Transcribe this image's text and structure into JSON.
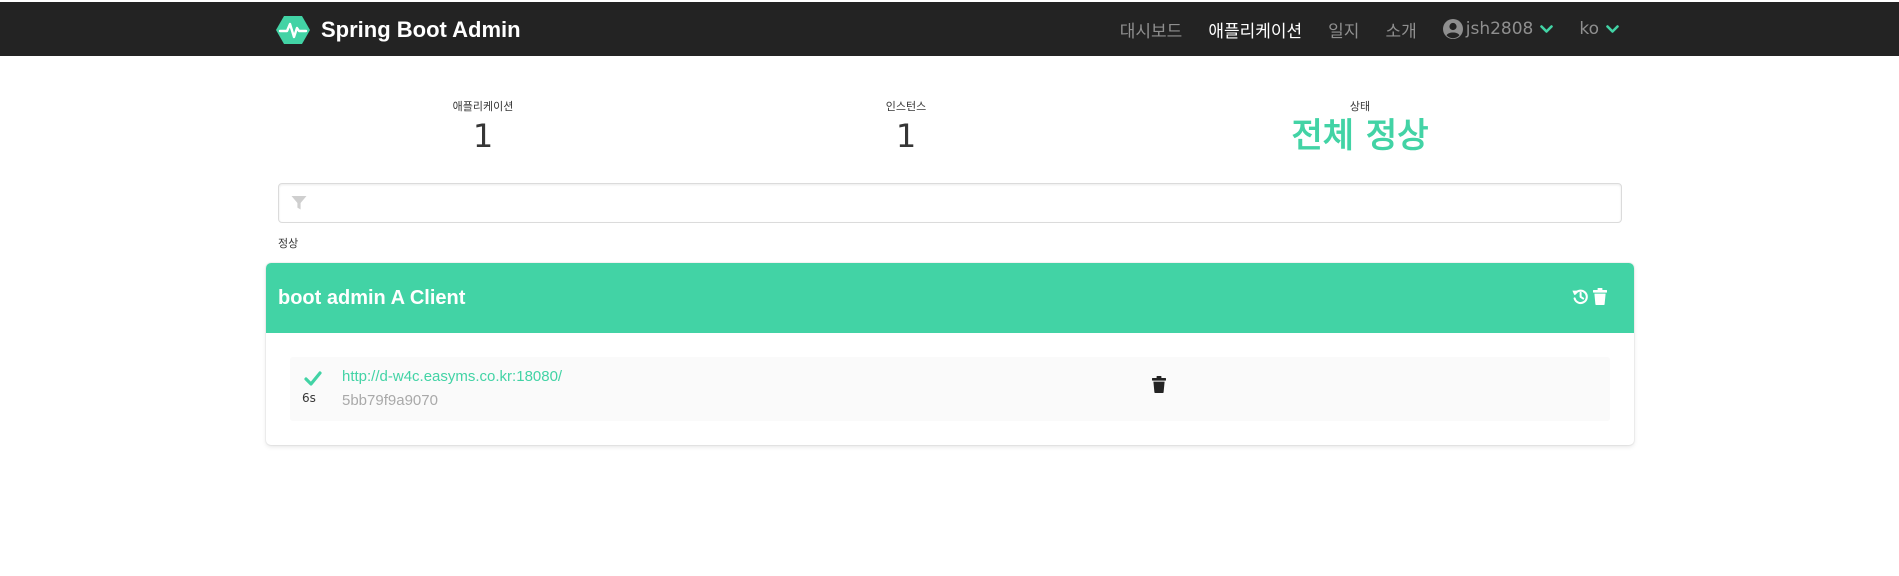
{
  "navbar": {
    "brand": {
      "logo_icon": "heartbeat-hexagon-icon",
      "title": "Spring Boot Admin"
    },
    "items": [
      {
        "label": "대시보드",
        "active": false
      },
      {
        "label": "애플리케이션",
        "active": true
      },
      {
        "label": "일지",
        "active": false
      },
      {
        "label": "소개",
        "active": false
      }
    ],
    "user": {
      "icon": "user-circle-icon",
      "name": "jsh2808",
      "dropdown_icon": "chevron-down-icon"
    },
    "language": {
      "value": "ko",
      "dropdown_icon": "chevron-down-icon"
    }
  },
  "summary": {
    "applications": {
      "label": "애플리케이션",
      "value": "1"
    },
    "instances": {
      "label": "인스턴스",
      "value": "1"
    },
    "status": {
      "label": "상태",
      "value": "전체 정상"
    }
  },
  "filter": {
    "icon": "filter-icon",
    "value": "",
    "placeholder": ""
  },
  "group": {
    "status_label": "정상",
    "application": {
      "name": "boot admin A Client",
      "actions": [
        {
          "icon": "history-icon"
        },
        {
          "icon": "trash-icon"
        }
      ],
      "instances": [
        {
          "status_icon": "check-icon",
          "age": "6s",
          "url": "http://d-w4c.easyms.co.kr:18080/",
          "id": "5bb79f9a9070",
          "delete_icon": "trash-icon"
        }
      ]
    }
  },
  "colors": {
    "navbar_bg": "#232323",
    "accent": "#42d3a5",
    "status_up": "#42d3a5",
    "text": "#363636",
    "muted": "#a9a9a9"
  }
}
